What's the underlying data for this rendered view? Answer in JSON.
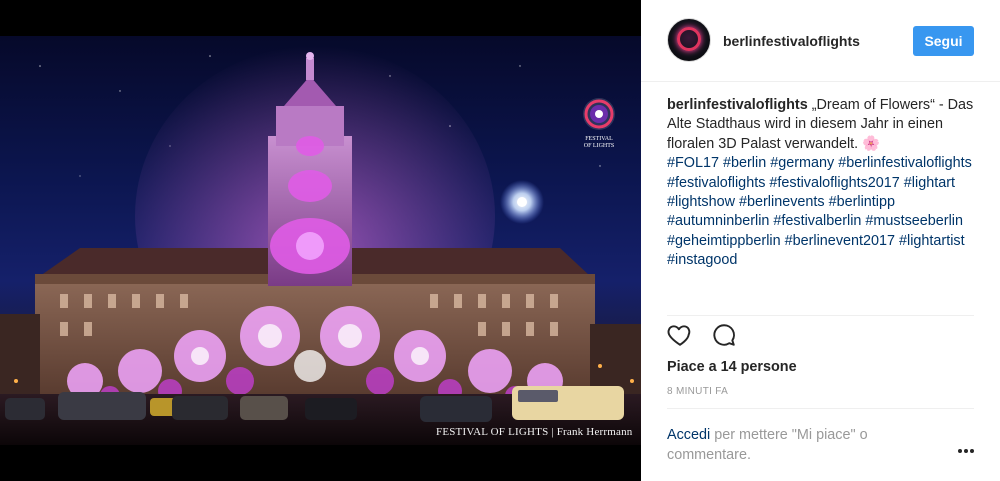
{
  "photo": {
    "credit": "FESTIVAL OF LIGHTS | Frank Herrmann",
    "logo_icon": "festival-of-lights-logo",
    "logo_text": "FESTIVAL OF LIGHTS"
  },
  "header": {
    "username": "berlinfestivaloflights",
    "follow_label": "Segui",
    "avatar_icon": "profile-avatar"
  },
  "caption": {
    "username": "berlinfestivaloflights",
    "text": "„Dream of Flowers“ - Das Alte Stadthaus wird in diesem Jahr in einen floralen 3D Palast verwandelt. 🌸",
    "hashtags": [
      "#FOL17",
      "#berlin",
      "#germany",
      "#berlinfestivaloflights",
      "#festivaloflights",
      "#festivaloflights2017",
      "#lightart",
      "#lightshow",
      "#berlinevents",
      "#berlintipp",
      "#autumninberlin",
      "#festivalberlin",
      "#mustseeberlin",
      "#geheimtippberlin",
      "#berlinevent2017",
      "#lightartist",
      "#instagood"
    ]
  },
  "actions": {
    "like_icon": "heart-icon",
    "comment_icon": "comment-icon"
  },
  "likes_text": "Piace a 14 persone",
  "timestamp": "8 MINUTI FA",
  "login_prompt": {
    "link": "Accedi",
    "text": " per mettere \"Mi piace\" o commentare."
  },
  "more_icon": "more-options-icon",
  "colors": {
    "accent": "#3897f0",
    "link": "#003569",
    "text": "#262626",
    "muted": "#999999",
    "projection": "#d04dd6"
  }
}
